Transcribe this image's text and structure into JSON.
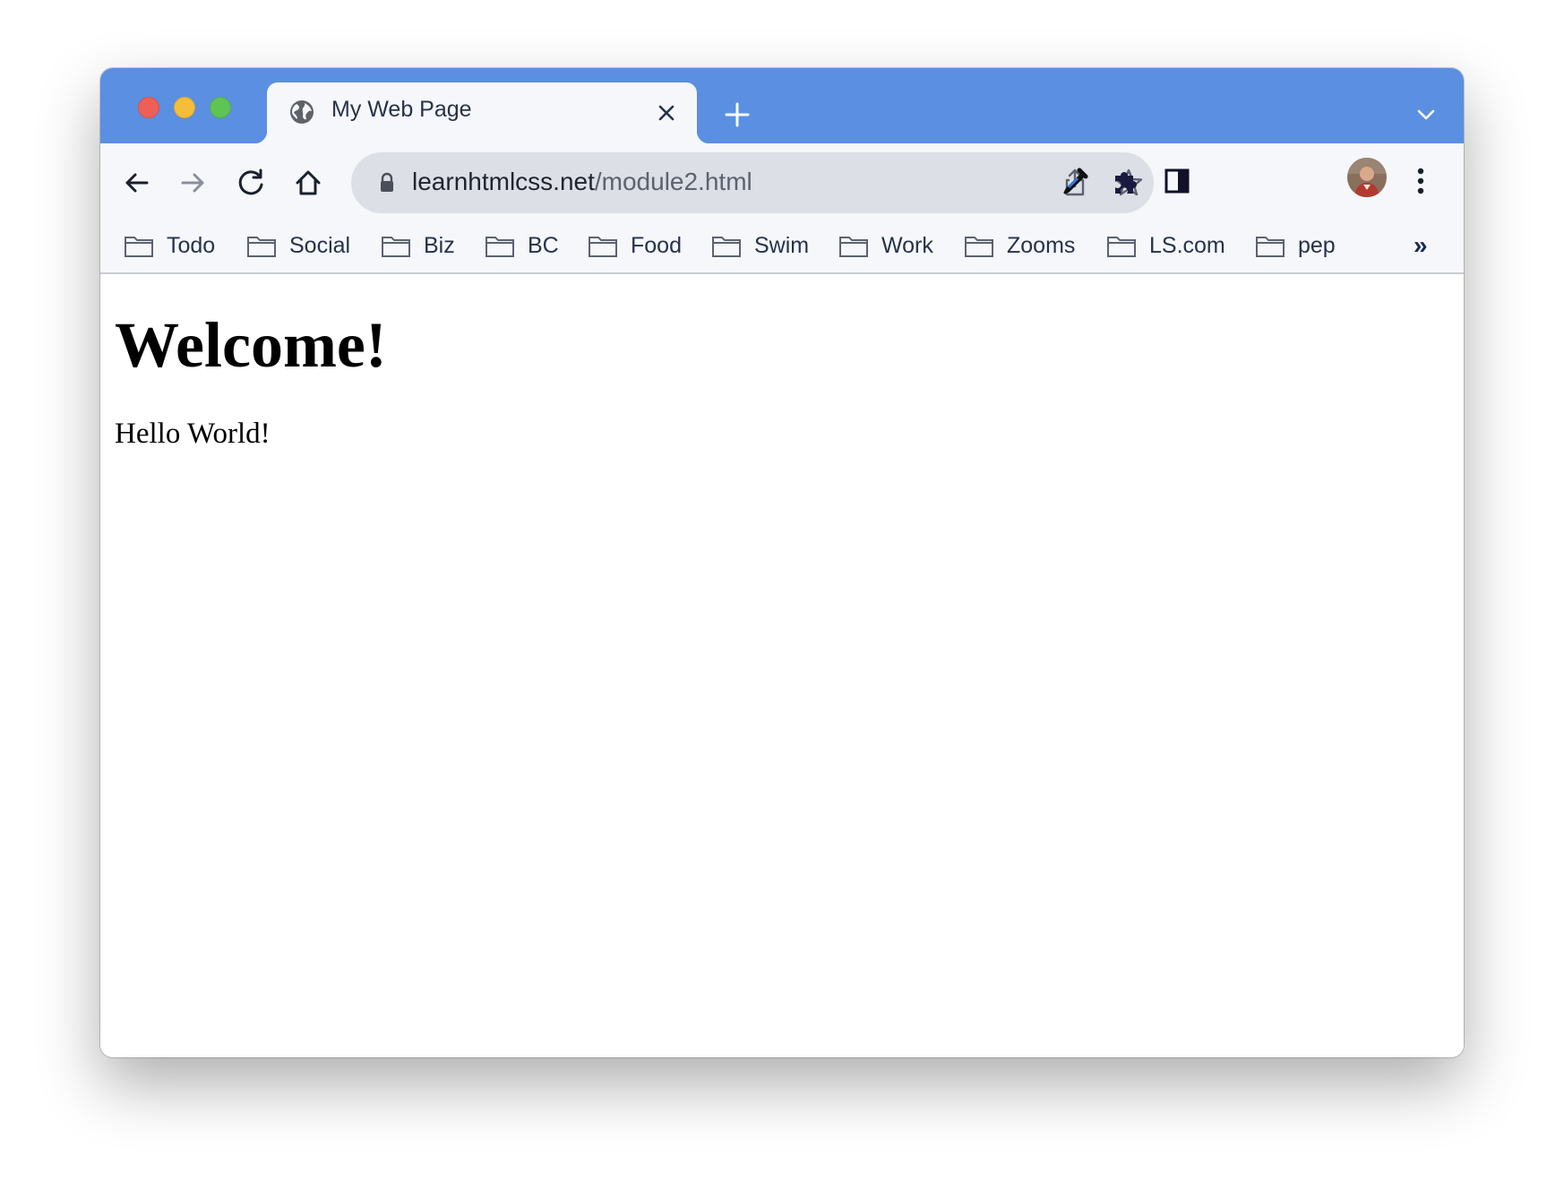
{
  "window": {
    "controls": [
      "close",
      "minimize",
      "maximize"
    ]
  },
  "tab": {
    "title": "My Web Page",
    "favicon": "globe-icon",
    "close_icon": "close-icon"
  },
  "toolbar": {
    "back_icon": "arrow-left-icon",
    "forward_icon": "arrow-right-icon",
    "reload_icon": "reload-icon",
    "home_icon": "home-icon",
    "extension_icons": [
      "eyedropper-icon",
      "puzzle-piece-icon",
      "side-panel-icon"
    ],
    "menu_icon": "kebab-menu-icon"
  },
  "address_bar": {
    "domain": "learnhtmlcss.net",
    "path": "/module2.html",
    "lock_icon": "lock-icon",
    "share_icon": "share-icon",
    "bookmark_icon": "star-icon"
  },
  "bookmarks": {
    "items": [
      {
        "label": "Todo"
      },
      {
        "label": "Social"
      },
      {
        "label": "Biz"
      },
      {
        "label": "BC"
      },
      {
        "label": "Food"
      },
      {
        "label": "Swim"
      },
      {
        "label": "Work"
      },
      {
        "label": "Zooms"
      },
      {
        "label": "LS.com"
      },
      {
        "label": "pep"
      }
    ],
    "overflow": "»"
  },
  "page": {
    "heading": "Welcome!",
    "paragraph": "Hello World!"
  },
  "colors": {
    "tabstrip": "#5a8fe2",
    "toolbar": "#f5f7fb",
    "omnibox": "#dcdfe5",
    "traffic_close": "#ee5f57",
    "traffic_minimize": "#f6bd3b",
    "traffic_maximize": "#5fc453"
  }
}
